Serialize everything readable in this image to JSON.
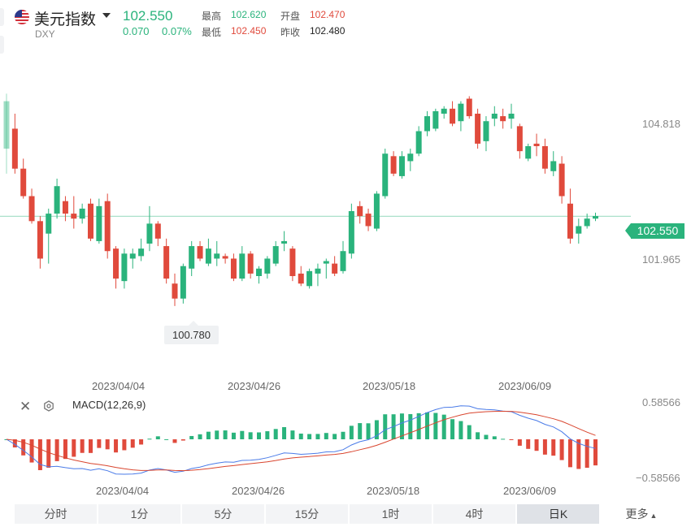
{
  "header": {
    "name": "美元指数",
    "symbol": "DXY",
    "price": "102.550",
    "change": "0.070",
    "change_pct": "0.07%",
    "high_label": "最高",
    "high": "102.620",
    "open_label": "开盘",
    "open": "102.470",
    "low_label": "最低",
    "low": "102.450",
    "prev_label": "昨收",
    "prev": "102.480"
  },
  "price_axis": {
    "top": "104.818",
    "bottom": "101.965",
    "last": "102.550"
  },
  "min_marker": "100.780",
  "dates": [
    "2023/04/04",
    "2023/04/26",
    "2023/05/18",
    "2023/06/09"
  ],
  "macd": {
    "label": "MACD(12,26,9)",
    "axis_top": "0.58566",
    "axis_bottom": "−0.58566"
  },
  "tabs": [
    {
      "label": "分时"
    },
    {
      "label": "1分"
    },
    {
      "label": "5分"
    },
    {
      "label": "15分"
    },
    {
      "label": "1时"
    },
    {
      "label": "4时"
    },
    {
      "label": "日K"
    }
  ],
  "more_label": "更多",
  "colors": {
    "up": "#2ab37c",
    "down": "#e04a3c",
    "dif": "#4a7be8",
    "dea": "#d9452e"
  },
  "chart_data": {
    "type": "candlestick",
    "price_range": [
      99.4,
      105.9
    ],
    "candles_ohlc": [
      [
        103.9,
        105.0,
        103.4,
        104.85
      ],
      [
        104.3,
        104.6,
        103.4,
        103.5
      ],
      [
        103.5,
        103.7,
        102.9,
        102.95
      ],
      [
        102.95,
        103.1,
        102.4,
        102.45
      ],
      [
        102.45,
        102.55,
        101.5,
        101.7
      ],
      [
        102.2,
        102.7,
        101.6,
        102.6
      ],
      [
        102.6,
        103.3,
        102.5,
        103.15
      ],
      [
        102.85,
        102.95,
        102.45,
        102.6
      ],
      [
        102.6,
        102.95,
        102.3,
        102.5
      ],
      [
        102.5,
        102.8,
        102.4,
        102.7
      ],
      [
        102.8,
        102.9,
        102.05,
        102.1
      ],
      [
        102.05,
        102.9,
        102.0,
        102.75
      ],
      [
        102.85,
        103.0,
        101.7,
        101.85
      ],
      [
        101.9,
        101.95,
        101.1,
        101.3
      ],
      [
        101.25,
        101.9,
        101.1,
        101.8
      ],
      [
        101.7,
        101.9,
        101.5,
        101.8
      ],
      [
        101.75,
        102.1,
        101.65,
        101.9
      ],
      [
        102.0,
        102.75,
        101.85,
        102.4
      ],
      [
        102.4,
        102.45,
        101.95,
        102.1
      ],
      [
        101.95,
        102.1,
        101.2,
        101.3
      ],
      [
        101.2,
        101.4,
        100.75,
        100.9
      ],
      [
        100.9,
        101.6,
        100.8,
        101.55
      ],
      [
        101.5,
        102.05,
        101.35,
        101.95
      ],
      [
        101.95,
        102.05,
        101.65,
        101.7
      ],
      [
        101.6,
        102.1,
        101.55,
        101.9
      ],
      [
        101.7,
        102.05,
        101.55,
        101.8
      ],
      [
        101.75,
        101.8,
        101.6,
        101.7
      ],
      [
        101.7,
        101.8,
        101.25,
        101.3
      ],
      [
        101.3,
        101.95,
        101.25,
        101.8
      ],
      [
        101.8,
        101.85,
        101.3,
        101.4
      ],
      [
        101.35,
        101.55,
        101.2,
        101.5
      ],
      [
        101.4,
        101.75,
        101.3,
        101.7
      ],
      [
        101.6,
        102.05,
        101.55,
        101.95
      ],
      [
        102.0,
        102.25,
        101.85,
        102.05
      ],
      [
        101.9,
        101.95,
        101.25,
        101.35
      ],
      [
        101.4,
        101.55,
        101.15,
        101.2
      ],
      [
        101.15,
        101.5,
        101.1,
        101.45
      ],
      [
        101.4,
        101.6,
        101.15,
        101.5
      ],
      [
        101.6,
        101.7,
        101.3,
        101.65
      ],
      [
        101.6,
        101.75,
        101.35,
        101.4
      ],
      [
        101.45,
        102.05,
        101.4,
        101.85
      ],
      [
        101.8,
        102.8,
        101.7,
        102.65
      ],
      [
        102.75,
        102.85,
        102.4,
        102.55
      ],
      [
        102.6,
        102.7,
        102.25,
        102.35
      ],
      [
        102.3,
        103.05,
        102.25,
        103.0
      ],
      [
        102.95,
        103.9,
        102.9,
        103.8
      ],
      [
        103.75,
        103.85,
        103.35,
        103.4
      ],
      [
        103.35,
        103.85,
        103.3,
        103.75
      ],
      [
        103.65,
        103.9,
        103.45,
        103.8
      ],
      [
        103.8,
        104.35,
        103.75,
        104.25
      ],
      [
        104.25,
        104.65,
        104.15,
        104.55
      ],
      [
        104.3,
        104.7,
        104.25,
        104.65
      ],
      [
        104.6,
        104.75,
        104.5,
        104.7
      ],
      [
        104.7,
        104.85,
        104.35,
        104.4
      ],
      [
        104.45,
        104.85,
        104.25,
        104.8
      ],
      [
        104.9,
        104.95,
        104.5,
        104.55
      ],
      [
        104.6,
        104.7,
        103.9,
        104.0
      ],
      [
        104.05,
        104.55,
        103.85,
        104.45
      ],
      [
        104.5,
        104.75,
        104.35,
        104.6
      ],
      [
        104.55,
        104.7,
        104.3,
        104.45
      ],
      [
        104.5,
        104.8,
        104.3,
        104.6
      ],
      [
        104.35,
        104.4,
        103.7,
        103.85
      ],
      [
        103.7,
        104.0,
        103.65,
        103.95
      ],
      [
        104.0,
        104.2,
        103.75,
        103.95
      ],
      [
        103.95,
        104.1,
        103.4,
        103.5
      ],
      [
        103.45,
        103.85,
        103.35,
        103.65
      ],
      [
        103.6,
        103.75,
        102.8,
        102.95
      ],
      [
        102.8,
        103.1,
        102.0,
        102.1
      ],
      [
        102.2,
        102.5,
        102.0,
        102.35
      ],
      [
        102.35,
        102.6,
        102.3,
        102.5
      ],
      [
        102.5,
        102.62,
        102.45,
        102.55
      ]
    ],
    "macd_range": [
      -0.58566,
      0.58566
    ]
  }
}
